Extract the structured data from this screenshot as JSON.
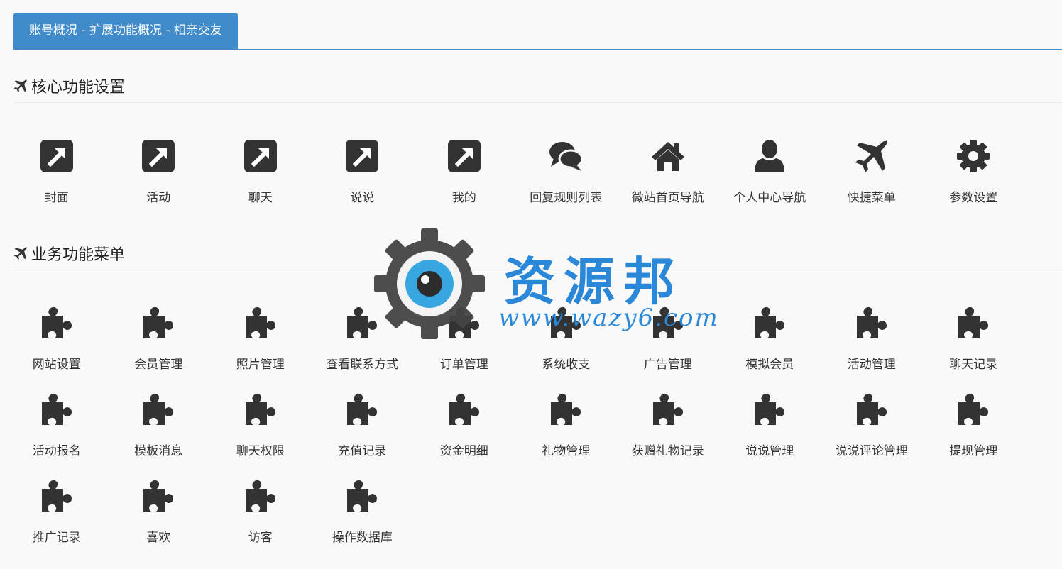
{
  "tab": {
    "label": "账号概况 - 扩展功能概况 - 相亲交友"
  },
  "sections": {
    "core": {
      "title": "核心功能设置"
    },
    "business": {
      "title": "业务功能菜单"
    }
  },
  "core_items": [
    {
      "label": "封面",
      "icon": "external-link-icon"
    },
    {
      "label": "活动",
      "icon": "external-link-icon"
    },
    {
      "label": "聊天",
      "icon": "external-link-icon"
    },
    {
      "label": "说说",
      "icon": "external-link-icon"
    },
    {
      "label": "我的",
      "icon": "external-link-icon"
    },
    {
      "label": "回复规则列表",
      "icon": "chat-bubbles-icon"
    },
    {
      "label": "微站首页导航",
      "icon": "home-icon"
    },
    {
      "label": "个人中心导航",
      "icon": "user-icon"
    },
    {
      "label": "快捷菜单",
      "icon": "plane-icon"
    },
    {
      "label": "参数设置",
      "icon": "gear-icon"
    }
  ],
  "business_items": [
    {
      "label": "网站设置",
      "icon": "puzzle-icon"
    },
    {
      "label": "会员管理",
      "icon": "puzzle-icon"
    },
    {
      "label": "照片管理",
      "icon": "puzzle-icon"
    },
    {
      "label": "查看联系方式",
      "icon": "puzzle-icon"
    },
    {
      "label": "订单管理",
      "icon": "puzzle-icon"
    },
    {
      "label": "系统收支",
      "icon": "puzzle-icon"
    },
    {
      "label": "广告管理",
      "icon": "puzzle-icon"
    },
    {
      "label": "模拟会员",
      "icon": "puzzle-icon"
    },
    {
      "label": "活动管理",
      "icon": "puzzle-icon"
    },
    {
      "label": "聊天记录",
      "icon": "puzzle-icon"
    },
    {
      "label": "活动报名",
      "icon": "puzzle-icon"
    },
    {
      "label": "模板消息",
      "icon": "puzzle-icon"
    },
    {
      "label": "聊天权限",
      "icon": "puzzle-icon"
    },
    {
      "label": "充值记录",
      "icon": "puzzle-icon"
    },
    {
      "label": "资金明细",
      "icon": "puzzle-icon"
    },
    {
      "label": "礼物管理",
      "icon": "puzzle-icon"
    },
    {
      "label": "获赠礼物记录",
      "icon": "puzzle-icon"
    },
    {
      "label": "说说管理",
      "icon": "puzzle-icon"
    },
    {
      "label": "说说评论管理",
      "icon": "puzzle-icon"
    },
    {
      "label": "提现管理",
      "icon": "puzzle-icon"
    },
    {
      "label": "推广记录",
      "icon": "puzzle-icon"
    },
    {
      "label": "喜欢",
      "icon": "puzzle-icon"
    },
    {
      "label": "访客",
      "icon": "puzzle-icon"
    },
    {
      "label": "操作数据库",
      "icon": "puzzle-icon"
    }
  ],
  "watermark": {
    "name": "资源邦",
    "url": "www.wazy6.com"
  },
  "colors": {
    "accent": "#428bca",
    "icon": "#333333",
    "watermark": "#2b88d8"
  }
}
